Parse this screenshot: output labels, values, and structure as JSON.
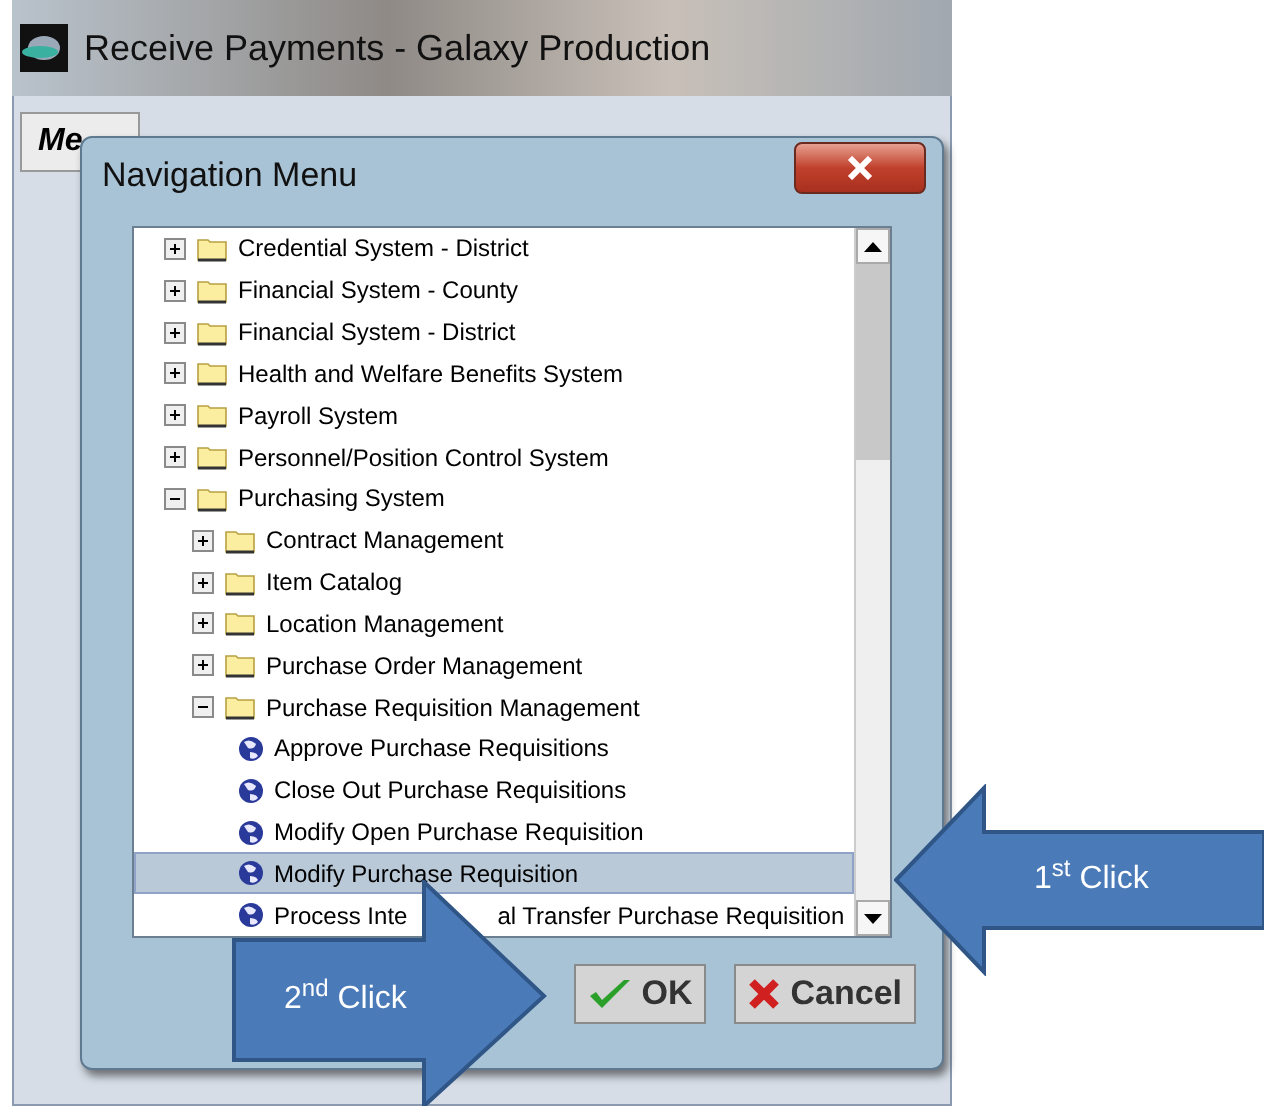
{
  "window": {
    "title": "Receive Payments - Galaxy Production",
    "menu_button": "Me"
  },
  "dialog": {
    "title": "Navigation Menu",
    "tree": [
      {
        "kind": "folder",
        "label": "Credential System - District",
        "expanded": false,
        "selected": false
      },
      {
        "kind": "folder",
        "label": "Financial System - County",
        "expanded": false,
        "selected": false
      },
      {
        "kind": "folder",
        "label": "Financial System - District",
        "expanded": false,
        "selected": false
      },
      {
        "kind": "folder",
        "label": "Health and Welfare Benefits System",
        "expanded": false,
        "selected": false
      },
      {
        "kind": "folder",
        "label": "Payroll System",
        "expanded": false,
        "selected": false
      },
      {
        "kind": "folder",
        "label": "Personnel/Position Control System",
        "expanded": false,
        "selected": false
      },
      {
        "kind": "folder",
        "label": "Purchasing System",
        "expanded": true,
        "selected": false,
        "children": [
          {
            "kind": "folder",
            "label": "Contract Management",
            "expanded": false,
            "selected": false
          },
          {
            "kind": "folder",
            "label": "Item Catalog",
            "expanded": false,
            "selected": false
          },
          {
            "kind": "folder",
            "label": "Location Management",
            "expanded": false,
            "selected": false
          },
          {
            "kind": "folder",
            "label": "Purchase Order Management",
            "expanded": false,
            "selected": false
          },
          {
            "kind": "folder",
            "label": "Purchase Requisition Management",
            "expanded": true,
            "selected": false,
            "children": [
              {
                "kind": "task",
                "label": "Approve Purchase Requisitions",
                "selected": false
              },
              {
                "kind": "task",
                "label": "Close Out Purchase Requisitions",
                "selected": false
              },
              {
                "kind": "task",
                "label": "Modify Open Purchase Requisition",
                "selected": false
              },
              {
                "kind": "task",
                "label": "Modify Purchase Requisition",
                "selected": true
              },
              {
                "kind": "task",
                "label": "Process Inte",
                "label_after_cover": "al Transfer Purchase Requisition",
                "selected": false
              }
            ]
          }
        ]
      }
    ],
    "buttons": [
      {
        "kind": "ok",
        "label": "OK"
      },
      {
        "kind": "cancel",
        "label": "Cancel"
      }
    ]
  },
  "callouts": [
    {
      "kind": "left",
      "text": "1$^{st}$ Click"
    },
    {
      "kind": "right",
      "text": "2$^{nd}$ Click"
    }
  ]
}
